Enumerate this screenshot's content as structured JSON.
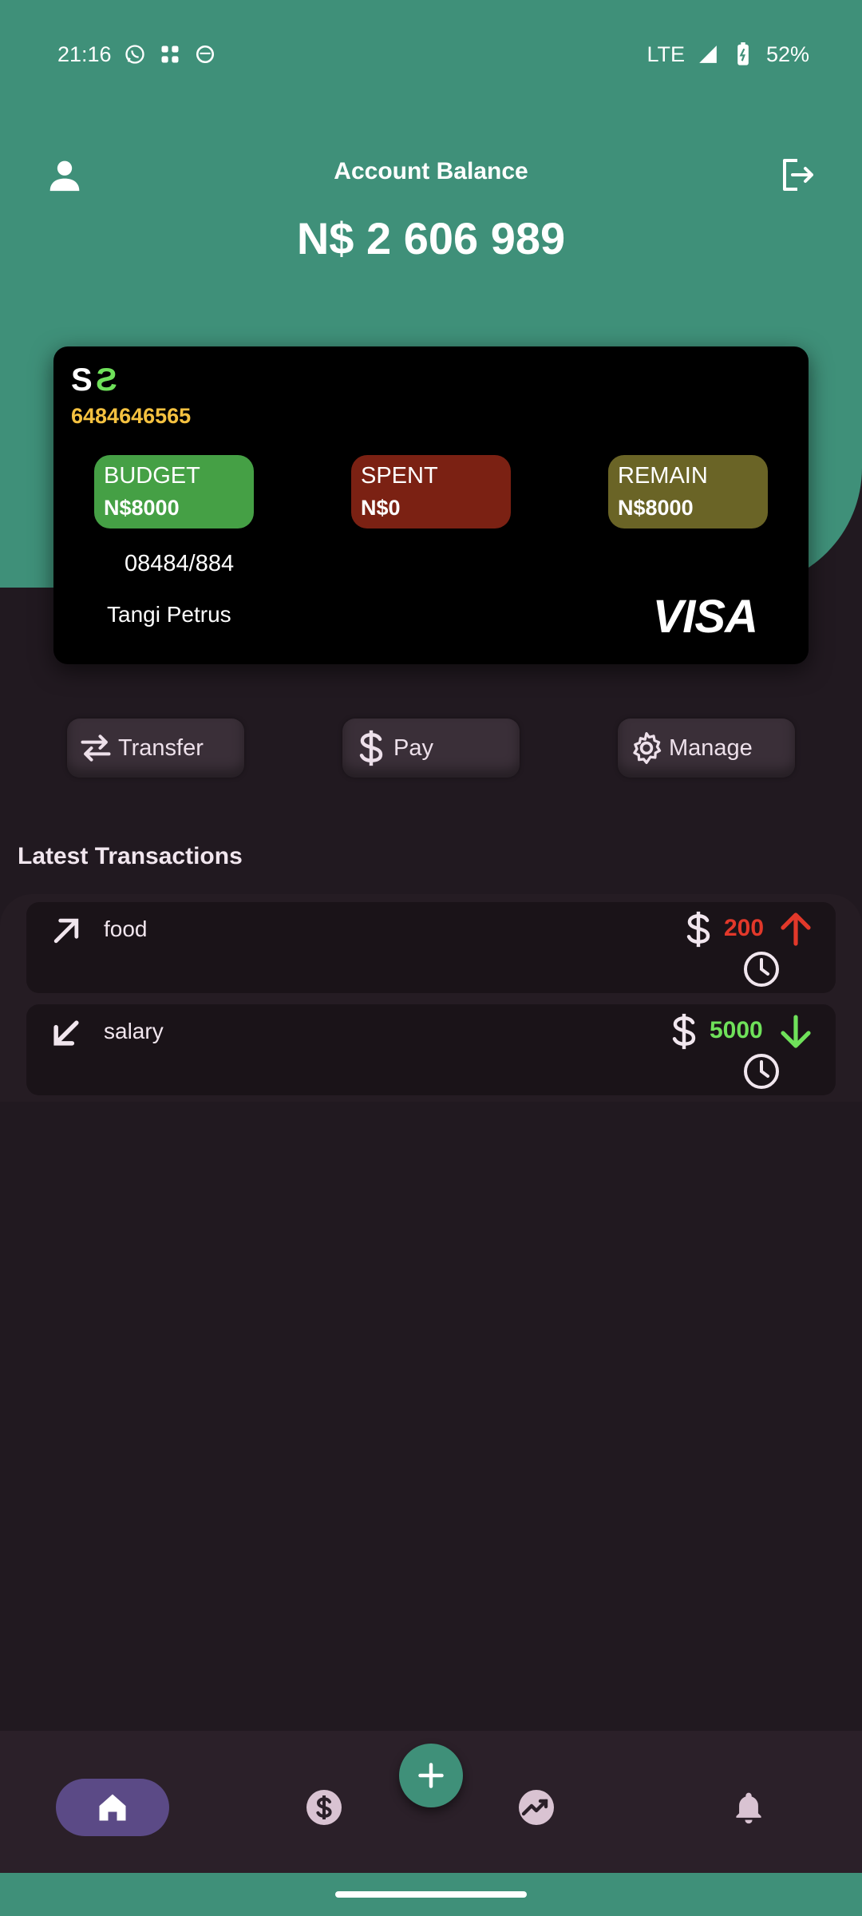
{
  "status_bar": {
    "time": "21:16",
    "network": "LTE",
    "battery": "52%",
    "icons": [
      "whatsapp-icon",
      "music-icon",
      "face-icon",
      "signal-icon",
      "battery-charging-icon"
    ]
  },
  "header": {
    "title": "Account Balance",
    "balance": "N$ 2 606 989",
    "left_icon": "person-icon",
    "right_icon": "logout-icon"
  },
  "card": {
    "logo_left": "S",
    "logo_right": "S",
    "number": "6484646565",
    "budget": {
      "label": "BUDGET",
      "amount": "N$8000"
    },
    "spent": {
      "label": "SPENT",
      "amount": "N$0"
    },
    "remain": {
      "label": "REMAIN",
      "amount": "N$8000"
    },
    "code": "08484/884",
    "holder": "Tangi Petrus",
    "brand": "VISA"
  },
  "actions": {
    "transfer": "Transfer",
    "pay": "Pay",
    "manage": "Manage"
  },
  "transactions": {
    "title": "Latest Transactions",
    "items": [
      {
        "name": "food",
        "amount": "200",
        "direction": "out",
        "color": "#e2382a"
      },
      {
        "name": "salary",
        "amount": "5000",
        "direction": "in",
        "color": "#6fe15a"
      }
    ]
  },
  "nav": {
    "items": [
      "home-icon",
      "money-icon",
      "add-icon",
      "chart-icon",
      "bell-icon"
    ],
    "active": "home-icon"
  },
  "colors": {
    "primary_green": "#3f9079",
    "background": "#211920",
    "budget": "#45a045",
    "spent": "#7b2113",
    "remain": "#6a6426",
    "card_number": "#f4c140"
  }
}
